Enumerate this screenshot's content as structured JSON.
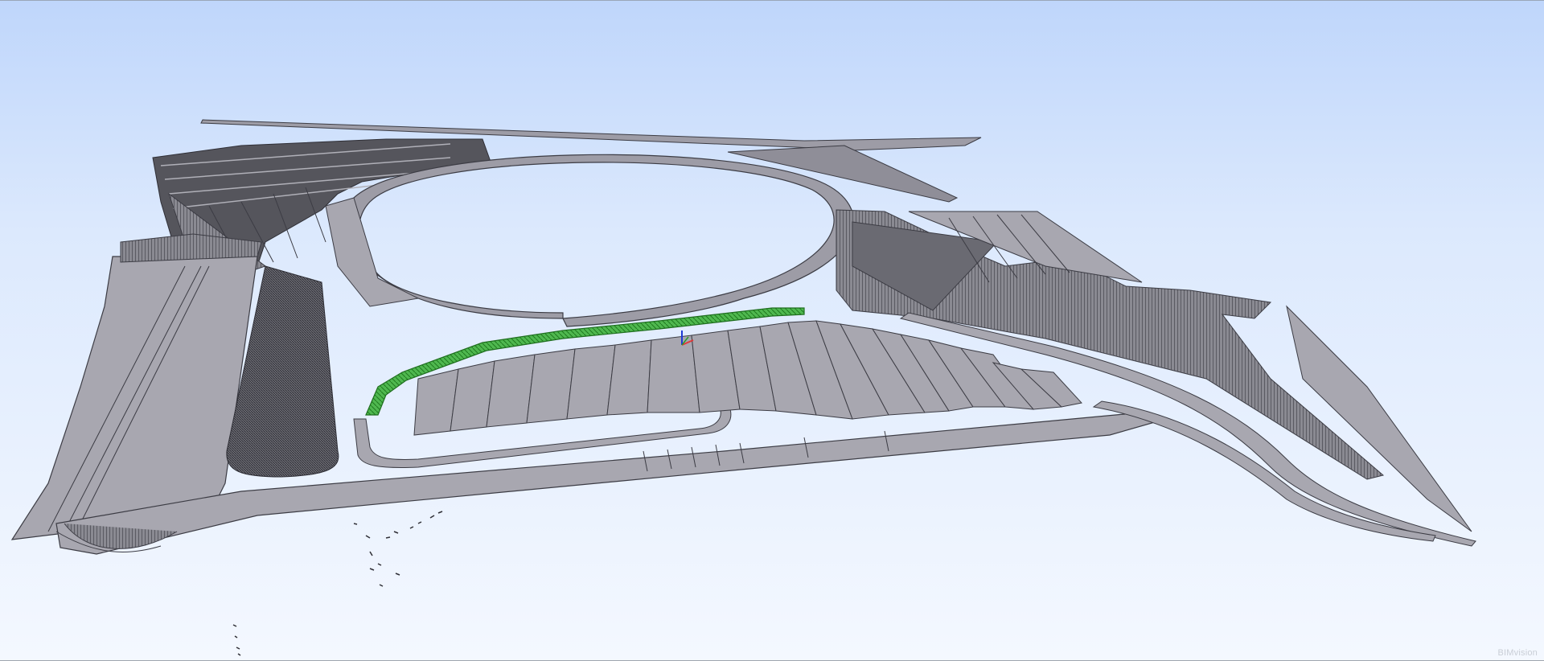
{
  "app": {
    "watermark": "BIMvision"
  },
  "viewport": {
    "background_top": "#bfd6fb",
    "background_bottom": "#f4f8ff",
    "model_fill": "#a8a7b0",
    "model_edge": "#3c3c44",
    "model_dark": "#55555c",
    "selection_color": "#2e9b2e",
    "axis_icons": [
      "axis-x-icon",
      "axis-y-icon",
      "axis-z-icon"
    ]
  }
}
